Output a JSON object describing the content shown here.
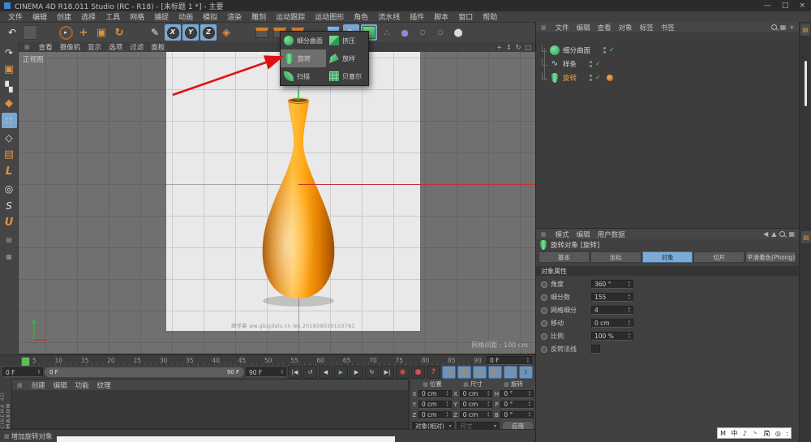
{
  "colors": {
    "selected_tab": "#7babd6",
    "selected_object_text": "#eaa43f",
    "vase_orange": "#f39c12",
    "arrow_red": "#de1212",
    "axis_red": "#c23434",
    "playhead_green": "#5abf5a",
    "generator_green": "#43b565"
  },
  "window": {
    "title": "CINEMA 4D R18.011 Studio (RC - R18) - [未标题 1 *] - 主要",
    "minimize": "—",
    "maximize": "□",
    "close": "×"
  },
  "menu_bar": [
    "文件",
    "编辑",
    "创建",
    "选择",
    "工具",
    "网格",
    "捕捉",
    "动画",
    "模拟",
    "渲染",
    "雕刻",
    "运动跟踪",
    "运动图形",
    "角色",
    "流水线",
    "插件",
    "脚本",
    "窗口",
    "帮助"
  ],
  "toolbar": {
    "buttons": [
      {
        "name": "undo-button",
        "glyph": "↶",
        "cls": "g-white"
      },
      {
        "name": "redo-button",
        "glyph": "",
        "cls": "t-empty"
      },
      {
        "name": "toolbar-separator",
        "glyph": "",
        "cls": "t-sep"
      },
      {
        "name": "live-selection-tool",
        "glyph": "▸",
        "cls": "t-circle"
      },
      {
        "name": "move-tool",
        "glyph": "+",
        "cls": "g-orange"
      },
      {
        "name": "scale-tool",
        "glyph": "▣",
        "cls": "g-orange"
      },
      {
        "name": "rotate-tool",
        "glyph": "↻",
        "cls": "g-orange"
      },
      {
        "name": "toolbar-separator",
        "glyph": "",
        "cls": "t-sep"
      },
      {
        "name": "last-tool-pen",
        "glyph": "✎",
        "cls": "g-white"
      },
      {
        "name": "x-axis-lock-button",
        "glyph": "X",
        "cls": "t-axis",
        "pressed": true
      },
      {
        "name": "y-axis-lock-button",
        "glyph": "Y",
        "cls": "t-axis",
        "pressed": true
      },
      {
        "name": "z-axis-lock-button",
        "glyph": "Z",
        "cls": "t-axis",
        "pressed": true
      },
      {
        "name": "workplane-button",
        "glyph": "◈",
        "cls": "g-orange"
      },
      {
        "name": "toolbar-separator",
        "glyph": "",
        "cls": "t-sep"
      },
      {
        "name": "render-view-button",
        "glyph": "",
        "cls": "t-clap"
      },
      {
        "name": "render-picture-viewer-button",
        "glyph": "",
        "cls": "t-clap"
      },
      {
        "name": "render-settings-button",
        "glyph": "",
        "cls": "t-clap"
      },
      {
        "name": "toolbar-separator",
        "glyph": "",
        "cls": "t-sep"
      },
      {
        "name": "add-primitive-button",
        "glyph": "",
        "cls": "t-cube-blue"
      },
      {
        "name": "draw-spline-button",
        "glyph": "✎",
        "cls": "g-white",
        "pressed": true
      },
      {
        "name": "add-generator-button",
        "glyph": "",
        "cls": "t-cube-green",
        "pressed": true
      },
      {
        "name": "add-modeling-button",
        "glyph": "∴",
        "cls": "g-green"
      },
      {
        "name": "add-deformer-button",
        "glyph": "●",
        "cls": "g-purple"
      },
      {
        "name": "scene-toggle-a",
        "glyph": "○",
        "cls": "g-dim"
      },
      {
        "name": "scene-toggle-b",
        "glyph": "○",
        "cls": "g-dim"
      },
      {
        "name": "add-environment-button",
        "glyph": "●",
        "cls": "g-light"
      }
    ]
  },
  "left_palette": [
    {
      "name": "make-editable-button",
      "glyph": "↷",
      "cls": "g-white"
    },
    {
      "name": "model-mode-button",
      "glyph": "▣",
      "cls": "g-orange"
    },
    {
      "name": "texture-mode-button",
      "glyph": "▚",
      "cls": "g-white"
    },
    {
      "name": "workplane-mode-button",
      "glyph": "◆",
      "cls": "g-orange"
    },
    {
      "name": "points-mode-button",
      "glyph": "∷",
      "cls": "g-white",
      "pressed": true
    },
    {
      "name": "edges-mode-button",
      "glyph": "◇",
      "cls": "g-white"
    },
    {
      "name": "polygons-mode-button",
      "glyph": "▤",
      "cls": "g-orange"
    },
    {
      "name": "enable-axis-button",
      "glyph": "L",
      "cls": "g-orange"
    },
    {
      "name": "viewport-solo-button",
      "glyph": "◎",
      "cls": "g-white"
    },
    {
      "name": "enable-snap-button",
      "glyph": "S",
      "cls": "g-white"
    },
    {
      "name": "quantize-button",
      "glyph": "U",
      "cls": "g-orange"
    },
    {
      "name": "workplane-lock-button",
      "glyph": "▤",
      "cls": "g-dim"
    },
    {
      "name": "workplane-snap-button",
      "glyph": "▦",
      "cls": "g-dim"
    }
  ],
  "viewport": {
    "menu": [
      "查看",
      "摄像机",
      "显示",
      "选项",
      "过滤",
      "面板"
    ],
    "nav_icons": [
      {
        "name": "pan-view-icon",
        "glyph": "+"
      },
      {
        "name": "zoom-view-icon",
        "glyph": "↕"
      },
      {
        "name": "rotate-view-icon",
        "glyph": "↻"
      },
      {
        "name": "toggle-view-icon",
        "glyph": "□"
      }
    ],
    "view_label": "正视图",
    "grid_spacing": "网格间距 : 100 cm",
    "watermark": "图怪兽  ww.gbzjdals.cn   No.201809030103781"
  },
  "popup": {
    "items": [
      {
        "label": "细分曲面",
        "icon": "subdivision-surface-icon"
      },
      {
        "label": "挤压",
        "icon": "extrude-icon"
      },
      {
        "label": "旋转",
        "icon": "lathe-icon",
        "highlighted": true
      },
      {
        "label": "放样",
        "icon": "loft-icon"
      },
      {
        "label": "扫描",
        "icon": "sweep-icon"
      },
      {
        "label": "贝塞尔",
        "icon": "bezier-icon"
      }
    ]
  },
  "object_manager": {
    "menu": [
      "文件",
      "编辑",
      "查看",
      "对象",
      "标签",
      "书签"
    ],
    "right_icons": [
      {
        "name": "search-icon",
        "glyph": "",
        "cls": "css-mag"
      },
      {
        "name": "filter-icon",
        "glyph": "▦"
      },
      {
        "name": "add-layer-icon",
        "glyph": "+"
      }
    ],
    "objects": [
      {
        "name": "细分曲面",
        "icon": "subdivision-surface-object-icon",
        "glyph": "",
        "selected": false,
        "has_tag": false
      },
      {
        "name": "样条",
        "icon": "spline-object-icon",
        "glyph": "∿",
        "selected": false,
        "has_tag": false
      },
      {
        "name": "旋转",
        "icon": "lathe-object-icon",
        "glyph": "",
        "selected": true,
        "has_tag": true
      }
    ]
  },
  "attribute_manager": {
    "menu": [
      "模式",
      "编辑",
      "用户数据"
    ],
    "right_icons": [
      {
        "name": "back-icon",
        "glyph": "◀"
      },
      {
        "name": "lock-icon",
        "glyph": "▲"
      },
      {
        "name": "search-icon",
        "glyph": "",
        "cls": "css-mag"
      },
      {
        "name": "panel-options-icon",
        "glyph": "▦"
      }
    ],
    "title": "旋转对象 [旋转]",
    "tabs": [
      {
        "label": "基本"
      },
      {
        "label": "坐标"
      },
      {
        "label": "对象",
        "selected": true
      },
      {
        "label": "切片"
      },
      {
        "label": "平滑着色(Phong)",
        "wide": true
      }
    ],
    "section": "对象属性",
    "fields": [
      {
        "label": "角度",
        "value": "360 °"
      },
      {
        "label": "细分数",
        "value": "155"
      },
      {
        "label": "网格细分",
        "value": "4"
      },
      {
        "label": "移动",
        "value": "0 cm"
      },
      {
        "label": "比例",
        "value": "100 %"
      },
      {
        "label": "反转法线",
        "checkbox": true
      }
    ]
  },
  "timeline": {
    "ticks": [
      "5",
      "10",
      "15",
      "20",
      "25",
      "30",
      "35",
      "40",
      "45",
      "50",
      "55",
      "60",
      "65",
      "70",
      "75",
      "80",
      "85",
      "90"
    ],
    "frame_field": "0 F"
  },
  "transport": {
    "start_field": "0 F",
    "slider_left_label": "0 F",
    "slider_right_label": "90 F",
    "end_field": "90 F",
    "buttons": [
      {
        "name": "goto-start-button",
        "glyph": "|◀"
      },
      {
        "name": "play-backwards-button",
        "glyph": "↺"
      },
      {
        "name": "previous-frame-button",
        "glyph": "◀"
      },
      {
        "name": "play-button",
        "glyph": "▶",
        "cls": "green"
      },
      {
        "name": "next-frame-button",
        "glyph": "▶"
      },
      {
        "name": "loop-button",
        "glyph": "↻"
      },
      {
        "name": "goto-end-button",
        "glyph": "▶|"
      }
    ],
    "record_buttons": [
      {
        "name": "record-active-objects-button",
        "glyph": "◉"
      },
      {
        "name": "autokey-button",
        "glyph": "●"
      },
      {
        "name": "keyframe-selection-button",
        "glyph": "?"
      }
    ],
    "key_buttons": [
      {
        "name": "key-position-button",
        "glyph": "+"
      },
      {
        "name": "key-scale-button",
        "glyph": "▣"
      },
      {
        "name": "key-rotation-button",
        "glyph": "○"
      },
      {
        "name": "key-parameter-button",
        "glyph": "P"
      },
      {
        "name": "key-pla-button",
        "glyph": "∷"
      }
    ],
    "options_glyph": "⋮"
  },
  "materials_panel": {
    "menu": [
      "创建",
      "编辑",
      "功能",
      "纹理"
    ]
  },
  "coordinates": {
    "headers": [
      "位置",
      "尺寸",
      "旋转"
    ],
    "rows": [
      {
        "l1": "X",
        "v1": "0 cm",
        "l2": "X",
        "v2": "0 cm",
        "l3": "H",
        "v3": "0 °"
      },
      {
        "l1": "Y",
        "v1": "0 cm",
        "l2": "Y",
        "v2": "0 cm",
        "l3": "P",
        "v3": "0 °"
      },
      {
        "l1": "Z",
        "v1": "0 cm",
        "l2": "Z",
        "v2": "0 cm",
        "l3": "B",
        "v3": "0 °"
      }
    ],
    "mode": "对象(相对)",
    "size_mode": "尺寸",
    "apply": "应用"
  },
  "status_bar": "增加旋转对象",
  "brand": {
    "line1": "MAXON",
    "line2": "CINEMA 4D"
  },
  "ime": [
    "M",
    "中",
    "♪",
    "丶",
    "简",
    "◎",
    ":"
  ]
}
